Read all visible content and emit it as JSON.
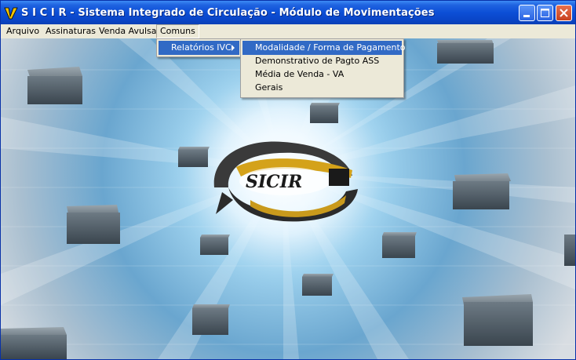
{
  "window": {
    "title": "S I C I R - Sistema Integrado de Circulação - Módulo de Movimentações",
    "icon": "sicir-app-icon"
  },
  "menubar": {
    "items": [
      {
        "label": "Arquivo"
      },
      {
        "label": "Assinaturas"
      },
      {
        "label": "Venda Avulsa"
      },
      {
        "label": "Comuns"
      }
    ]
  },
  "comuns_menu": {
    "items": [
      {
        "label": "Relatórios IVC",
        "has_submenu": true
      }
    ]
  },
  "relatorios_menu": {
    "items": [
      {
        "label": "Modalidade / Forma de Pagamento"
      },
      {
        "label": "Demonstrativo de Pagto ASS"
      },
      {
        "label": "Média de Venda - VA"
      },
      {
        "label": "Gerais"
      }
    ]
  },
  "logo": {
    "text": "SICIR"
  },
  "colors": {
    "titlebar": "#0c4fd6",
    "highlight": "#316ac5",
    "menu_bg": "#ece9d8",
    "close_button": "#c8421f"
  }
}
